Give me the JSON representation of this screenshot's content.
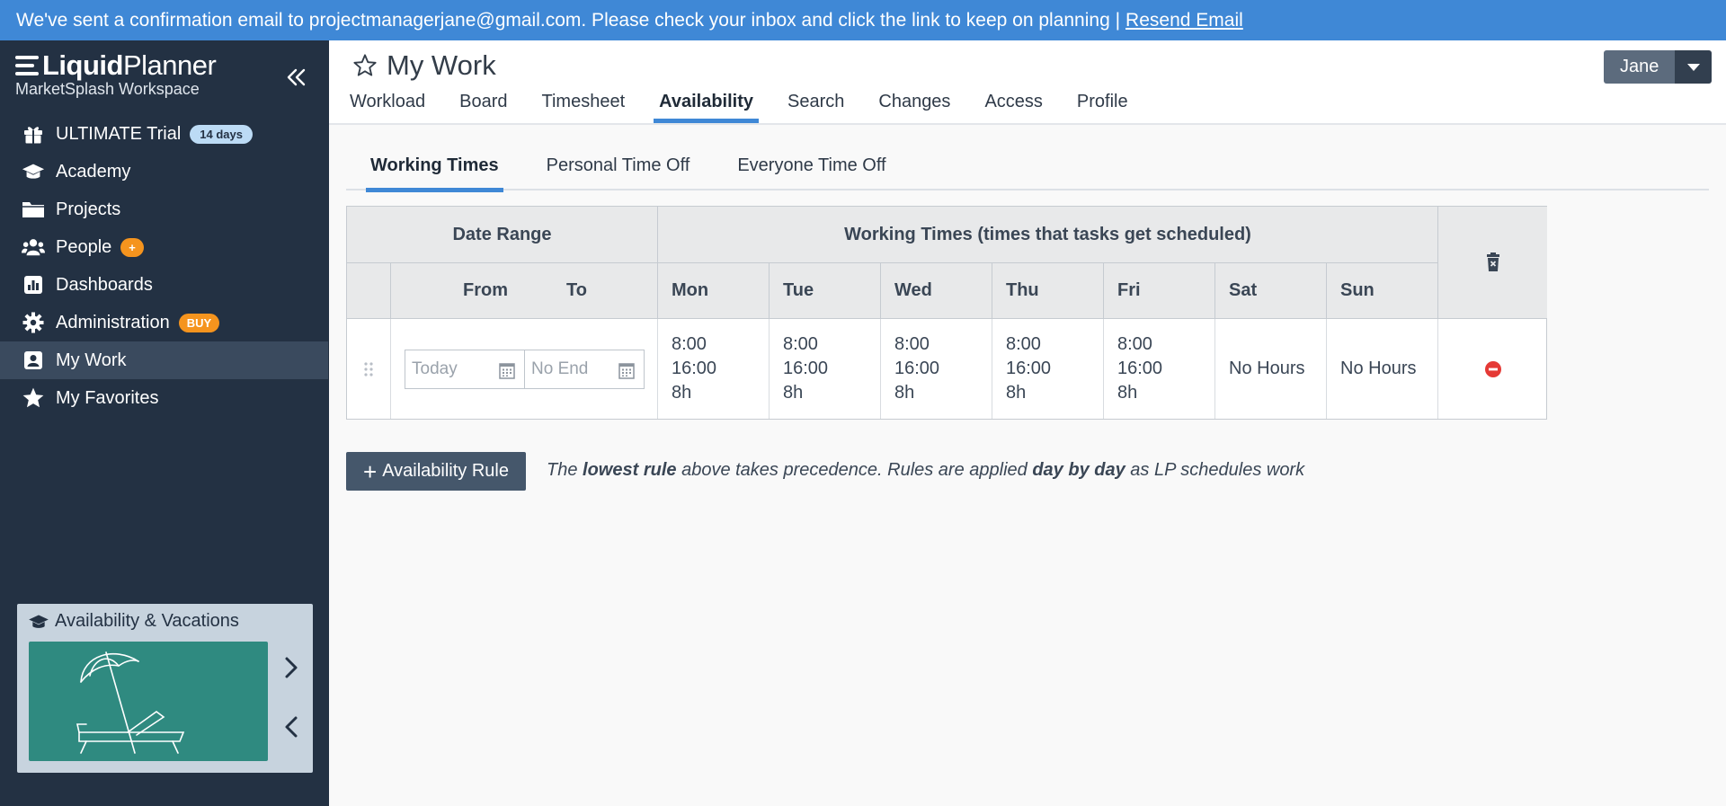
{
  "banner": {
    "message": "We've sent a confirmation email to projectmanagerjane@gmail.com. Please check your inbox and click the link to keep on planning |",
    "link": "Resend Email"
  },
  "sidebar": {
    "logo_light": "Liquid",
    "logo_bold_part": "Planner",
    "workspace": "MarketSplash Workspace",
    "items": [
      {
        "label": "ULTIMATE Trial",
        "icon": "gift-icon",
        "badge": "14 days"
      },
      {
        "label": "Academy",
        "icon": "graduation-cap-icon"
      },
      {
        "label": "Projects",
        "icon": "folder-icon"
      },
      {
        "label": "People",
        "icon": "people-icon",
        "badge": "+"
      },
      {
        "label": "Dashboards",
        "icon": "dashboard-icon"
      },
      {
        "label": "Administration",
        "icon": "gear-icon",
        "badge": "BUY"
      },
      {
        "label": "My Work",
        "icon": "user-badge-icon",
        "active": true
      },
      {
        "label": "My Favorites",
        "icon": "star-icon"
      }
    ],
    "promo": {
      "title": "Availability & Vacations",
      "image": "beach-umbrella-chair-illustration"
    }
  },
  "header": {
    "title": "My Work",
    "tabs": [
      "Workload",
      "Board",
      "Timesheet",
      "Availability",
      "Search",
      "Changes",
      "Access",
      "Profile"
    ],
    "active_tab": "Availability",
    "user": "Jane"
  },
  "subtabs": {
    "items": [
      "Working Times",
      "Personal Time Off",
      "Everyone Time Off"
    ],
    "active": "Working Times"
  },
  "table": {
    "group_headers": {
      "date_range": "Date Range",
      "working_times": "Working Times (times that tasks get scheduled)"
    },
    "headers": {
      "from": "From",
      "to": "To",
      "days": [
        "Mon",
        "Tue",
        "Wed",
        "Thu",
        "Fri",
        "Sat",
        "Sun"
      ]
    },
    "row": {
      "from_placeholder": "Today",
      "to_placeholder": "No End",
      "days": [
        {
          "start": "8:00",
          "end": "16:00",
          "hours": "8h"
        },
        {
          "start": "8:00",
          "end": "16:00",
          "hours": "8h"
        },
        {
          "start": "8:00",
          "end": "16:00",
          "hours": "8h"
        },
        {
          "start": "8:00",
          "end": "16:00",
          "hours": "8h"
        },
        {
          "start": "8:00",
          "end": "16:00",
          "hours": "8h"
        },
        {
          "none": "No Hours"
        },
        {
          "none": "No Hours"
        }
      ]
    }
  },
  "add_rule_label": "Availability Rule",
  "hint": {
    "p1": "The",
    "b1": "lowest rule",
    "p2": "above takes precedence. Rules are applied",
    "b2": "day by day",
    "p3": "as LP schedules work"
  },
  "colors": {
    "banner": "#3f88d6",
    "sidebar": "#233143",
    "accent": "#3f88d6",
    "badge_orange": "#f5941e",
    "remove_red": "#e53935"
  }
}
